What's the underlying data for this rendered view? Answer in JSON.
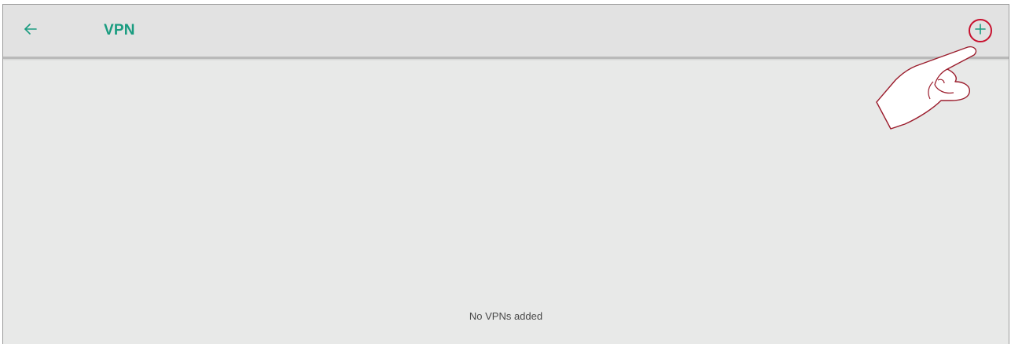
{
  "app_bar": {
    "back_icon": "arrow-left-icon",
    "title": "VPN",
    "add_icon": "plus-icon"
  },
  "main": {
    "empty_message": "No VPNs added"
  },
  "overlay": {
    "pointer_icon": "pointing-hand-icon"
  },
  "colors": {
    "accent": "#1a9c80",
    "highlight_ring": "#c8102e",
    "background": "#e8e9e8",
    "app_bar": "#e2e2e2"
  }
}
